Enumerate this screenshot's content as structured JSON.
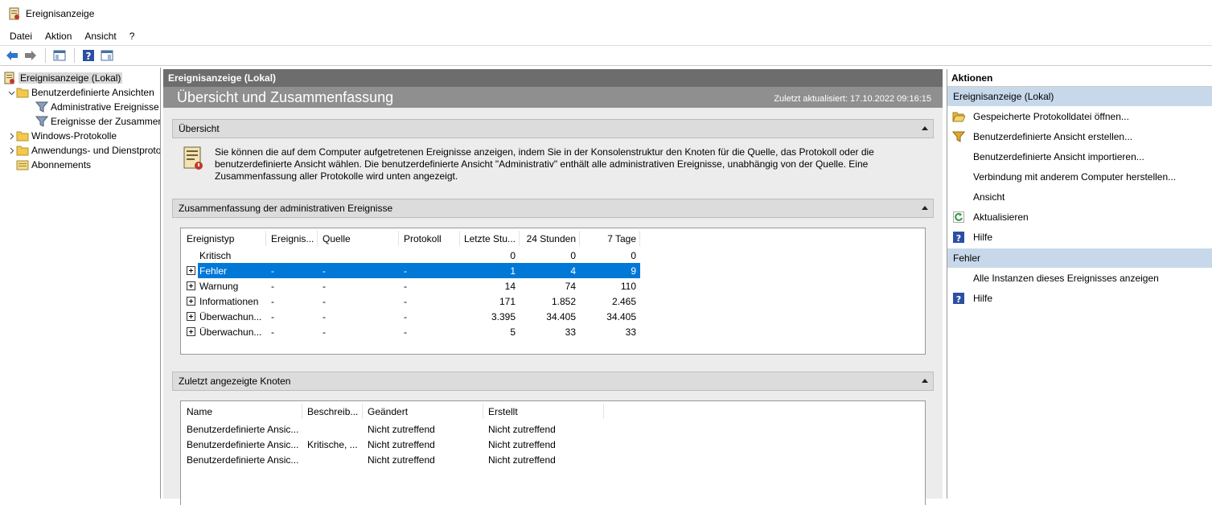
{
  "window": {
    "title": "Ereignisanzeige"
  },
  "menu": [
    "Datei",
    "Aktion",
    "Ansicht",
    "?"
  ],
  "tree": [
    {
      "label": "Ereignisanzeige (Lokal)",
      "level": 0,
      "expander": "",
      "icon": "event-viewer-icon",
      "selected": true
    },
    {
      "label": "Benutzerdefinierte Ansichten",
      "level": 1,
      "expander": "down",
      "icon": "folder-icon"
    },
    {
      "label": "Administrative Ereignisse",
      "level": 2,
      "expander": "",
      "icon": "filter-icon"
    },
    {
      "label": "Ereignisse der Zusammenfassung",
      "level": 2,
      "expander": "",
      "icon": "filter-icon"
    },
    {
      "label": "Windows-Protokolle",
      "level": 1,
      "expander": "right",
      "icon": "folder-icon"
    },
    {
      "label": "Anwendungs- und Dienstprotokolle",
      "level": 1,
      "expander": "right",
      "icon": "folder-icon"
    },
    {
      "label": "Abonnements",
      "level": 1,
      "expander": "",
      "icon": "subscriptions-icon"
    }
  ],
  "center": {
    "header": "Ereignisanzeige (Lokal)",
    "title": "Übersicht und Zusammenfassung",
    "updated": "Zuletzt aktualisiert: 17.10.2022 09:16:15",
    "overview": {
      "header": "Übersicht",
      "text": "Sie können die auf dem Computer aufgetretenen Ereignisse anzeigen, indem Sie in der Konsolenstruktur den Knoten für die Quelle, das Protokoll oder die benutzerdefinierte Ansicht wählen. Die benutzerdefinierte Ansicht \"Administrativ\" enthält alle administrativen Ereignisse, unabhängig von der Quelle. Eine Zusammenfassung aller Protokolle wird unten angezeigt."
    },
    "summary": {
      "header": "Zusammenfassung der administrativen Ereignisse",
      "columns": [
        "Ereignistyp",
        "Ereignis...",
        "Quelle",
        "Protokoll",
        "Letzte Stu...",
        "24 Stunden",
        "7 Tage"
      ],
      "rows": [
        {
          "type": "Kritisch",
          "id": "",
          "source": "",
          "log": "",
          "hour": "0",
          "day": "0",
          "week": "0",
          "expandable": false,
          "selected": false
        },
        {
          "type": "Fehler",
          "id": "-",
          "source": "-",
          "log": "-",
          "hour": "1",
          "day": "4",
          "week": "9",
          "expandable": true,
          "selected": true
        },
        {
          "type": "Warnung",
          "id": "-",
          "source": "-",
          "log": "-",
          "hour": "14",
          "day": "74",
          "week": "110",
          "expandable": true,
          "selected": false
        },
        {
          "type": "Informationen",
          "id": "-",
          "source": "-",
          "log": "-",
          "hour": "171",
          "day": "1.852",
          "week": "2.465",
          "expandable": true,
          "selected": false
        },
        {
          "type": "Überwachun...",
          "id": "-",
          "source": "-",
          "log": "-",
          "hour": "3.395",
          "day": "34.405",
          "week": "34.405",
          "expandable": true,
          "selected": false
        },
        {
          "type": "Überwachun...",
          "id": "-",
          "source": "-",
          "log": "-",
          "hour": "5",
          "day": "33",
          "week": "33",
          "expandable": true,
          "selected": false
        }
      ]
    },
    "recent": {
      "header": "Zuletzt angezeigte Knoten",
      "columns": [
        "Name",
        "Beschreib...",
        "Geändert",
        "Erstellt"
      ],
      "rows": [
        {
          "name": "Benutzerdefinierte Ansic...",
          "desc": "",
          "changed": "Nicht zutreffend",
          "created": "Nicht zutreffend"
        },
        {
          "name": "Benutzerdefinierte Ansic...",
          "desc": "Kritische, ...",
          "changed": "Nicht zutreffend",
          "created": "Nicht zutreffend"
        },
        {
          "name": "Benutzerdefinierte Ansic...",
          "desc": "",
          "changed": "Nicht zutreffend",
          "created": "Nicht zutreffend"
        }
      ]
    }
  },
  "actions": {
    "header": "Aktionen",
    "sections": [
      {
        "title": "Ereignisanzeige (Lokal)",
        "items": [
          {
            "label": "Gespeicherte Protokolldatei öffnen...",
            "icon": "open-folder-icon"
          },
          {
            "label": "Benutzerdefinierte Ansicht erstellen...",
            "icon": "filter-icon"
          },
          {
            "label": "Benutzerdefinierte Ansicht importieren...",
            "icon": ""
          },
          {
            "label": "Verbindung mit anderem Computer herstellen...",
            "icon": ""
          },
          {
            "label": "Ansicht",
            "icon": ""
          },
          {
            "label": "Aktualisieren",
            "icon": "refresh-icon"
          },
          {
            "label": "Hilfe",
            "icon": "help-icon"
          }
        ]
      },
      {
        "title": "Fehler",
        "items": [
          {
            "label": "Alle Instanzen dieses Ereignisses anzeigen",
            "icon": ""
          },
          {
            "label": "Hilfe",
            "icon": "help-icon"
          }
        ]
      }
    ]
  }
}
